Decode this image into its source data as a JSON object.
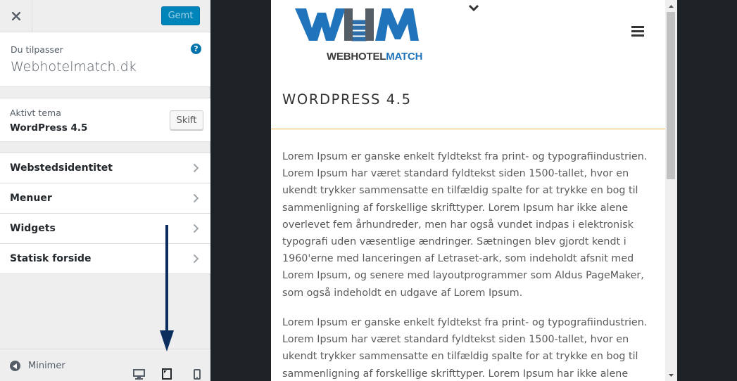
{
  "customizer": {
    "save_label": "Gemt",
    "info_label": "Du tilpasser",
    "site_name": "Webhotelmatch.dk",
    "help_glyph": "?",
    "active_theme_label": "Aktivt tema",
    "active_theme_name": "WordPress 4.5",
    "switch_label": "Skift",
    "panels": [
      {
        "label": "Webstedsidentitet"
      },
      {
        "label": "Menuer"
      },
      {
        "label": "Widgets"
      },
      {
        "label": "Statisk forside"
      }
    ],
    "collapse_label": "Minimer",
    "devices": [
      "desktop-icon",
      "tablet-icon",
      "mobile-icon"
    ],
    "active_device": "tablet-icon"
  },
  "preview": {
    "logo_part_1": "WEBHOTEL",
    "logo_part_2": "MATCH",
    "page_title": "WORDPRESS 4.5",
    "paragraphs": [
      "Lorem Ipsum er ganske enkelt fyldtekst fra print- og typografiindustrien. Lorem Ipsum har været standard fyldtekst siden 1500-tallet, hvor en ukendt trykker sammensatte en tilfældig spalte for at trykke en bog til sammenligning af forskellige skrifttyper. Lorem Ipsum har ikke alene overlevet fem århundreder, men har også vundet indpas i elektronisk typografi uden væsentlige ændringer. Sætningen blev gjordt kendt i 1960'erne med lanceringen af Letraset-ark, som indeholdt afsnit med Lorem Ipsum, og senere med layoutprogrammer som Aldus PageMaker, som også indeholdt en udgave af Lorem Ipsum.",
      "Lorem Ipsum er ganske enkelt fyldtekst fra print- og typografiindustrien. Lorem Ipsum har været standard fyldtekst siden 1500-tallet, hvor en ukendt trykker sammensatte en tilfældig spalte for at trykke en bog til sammenligning af forskellige skrifttyper. Lorem Ipsum har ikke alene"
    ]
  },
  "colors": {
    "accent": "#0085ba",
    "title_rule": "#e8b73d",
    "logo_blue": "#1f74bb",
    "annotation_arrow": "#0b2e5c"
  }
}
